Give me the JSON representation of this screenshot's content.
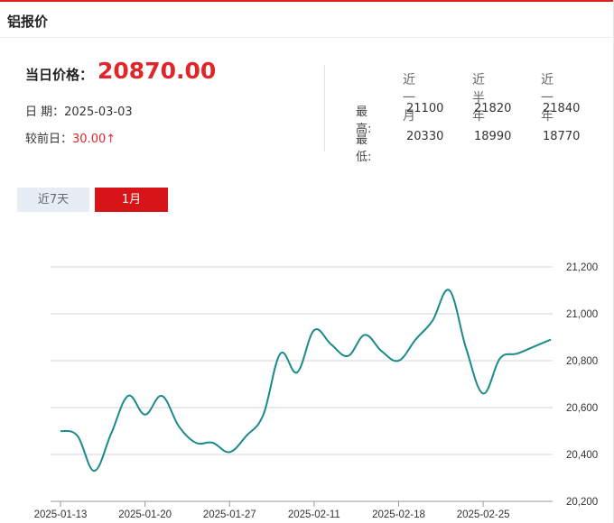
{
  "header": {
    "title": "铝报价"
  },
  "price": {
    "label": "当日价格：",
    "value": "20870.00",
    "date_label": "日 期：",
    "date": "2025-03-03",
    "change_label": "较前日：",
    "change": "30.00",
    "change_arrow": "↑"
  },
  "stats": {
    "columns": [
      "近一月",
      "近半年",
      "近一年"
    ],
    "rows": [
      {
        "label": "最高:",
        "values": [
          "21100",
          "21820",
          "21840"
        ]
      },
      {
        "label": "最低:",
        "values": [
          "20330",
          "18990",
          "18770"
        ]
      }
    ]
  },
  "tabs": [
    {
      "label": "近7天",
      "active": false
    },
    {
      "label": "1月",
      "active": true
    }
  ],
  "colors": {
    "accent": "#d71518",
    "line": "#1a8a8a",
    "price": "#e0262b"
  },
  "chart_data": {
    "type": "line",
    "title": "",
    "xlabel": "",
    "ylabel": "",
    "ylim": [
      20200,
      21200
    ],
    "yticks": [
      20200,
      20400,
      20600,
      20800,
      21000,
      21200
    ],
    "ytick_labels": [
      "20,200",
      "20,400",
      "20,600",
      "20,800",
      "21,000",
      "21,200"
    ],
    "xtick_labels": [
      "2025-01-13",
      "2025-01-20",
      "2025-01-27",
      "2025-02-11",
      "2025-02-18",
      "2025-02-25"
    ],
    "grid": true,
    "series": [
      {
        "x": [
          "2025-01-13",
          "2025-01-14",
          "2025-01-15",
          "2025-01-16",
          "2025-01-17",
          "2025-01-20",
          "2025-01-21",
          "2025-01-22",
          "2025-01-23",
          "2025-01-24",
          "2025-01-27",
          "2025-02-05",
          "2025-02-06",
          "2025-02-07",
          "2025-02-10",
          "2025-02-11",
          "2025-02-12",
          "2025-02-13",
          "2025-02-14",
          "2025-02-17",
          "2025-02-18",
          "2025-02-19",
          "2025-02-20",
          "2025-02-21",
          "2025-02-24",
          "2025-02-25",
          "2025-02-26",
          "2025-02-27",
          "2025-02-28",
          "2025-03-03"
        ],
        "values": [
          20500,
          20480,
          20330,
          20490,
          20650,
          20570,
          20650,
          20520,
          20450,
          20450,
          20410,
          20480,
          20570,
          20830,
          20750,
          20930,
          20870,
          20820,
          20910,
          20840,
          20800,
          20890,
          20970,
          21100,
          20850,
          20660,
          20810,
          20830,
          20860,
          20890
        ]
      }
    ]
  }
}
